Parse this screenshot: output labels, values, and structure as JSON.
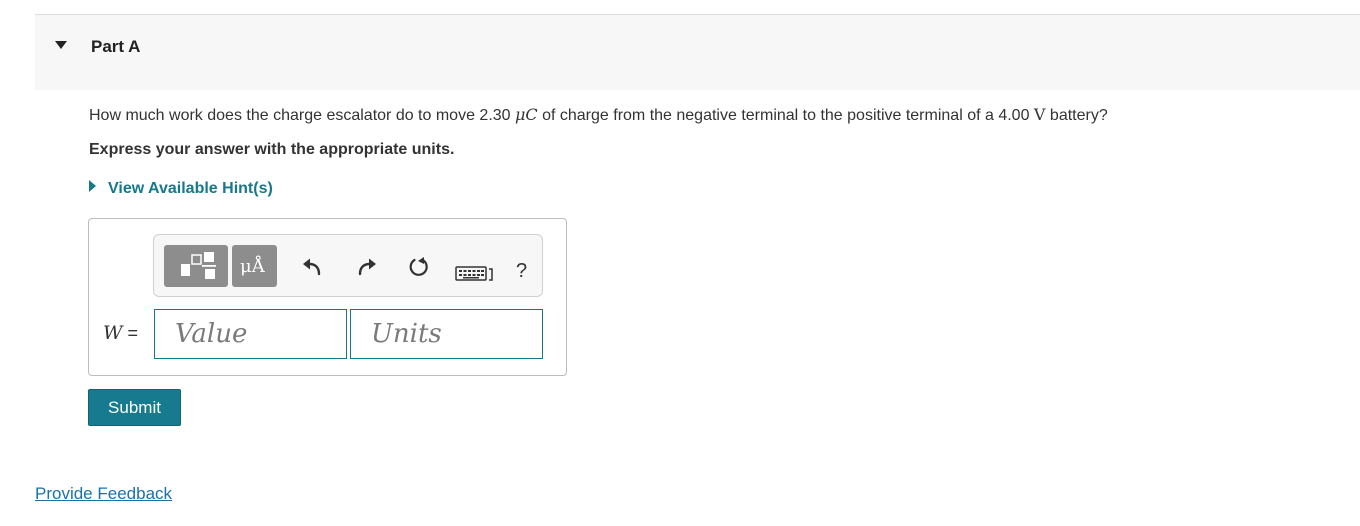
{
  "part": {
    "title": "Part A"
  },
  "question": {
    "text_1": "How much work does the charge escalator do to move 2.30 ",
    "unit_charge": "μC",
    "text_2": " of charge from the negative terminal to the positive terminal of a 4.00 ",
    "unit_voltage": "V",
    "text_3": " battery?"
  },
  "instruction": "Express your answer with the appropriate units.",
  "hint": {
    "label": "View Available Hint(s)"
  },
  "answer": {
    "variable": "W",
    "equals": " =",
    "value_placeholder": "Value",
    "units_placeholder": "Units"
  },
  "toolbar": {
    "units_glyph": "μÅ",
    "help_label": "?",
    "icons": [
      "templates-icon",
      "units-icon",
      "undo-icon",
      "redo-icon",
      "reset-icon",
      "keyboard-icon",
      "help-icon"
    ]
  },
  "submit_label": "Submit",
  "feedback_label": "Provide Feedback",
  "colors": {
    "accent": "#16798a",
    "link": "#1a72a8",
    "toolbar_button": "#8d8d8d"
  }
}
